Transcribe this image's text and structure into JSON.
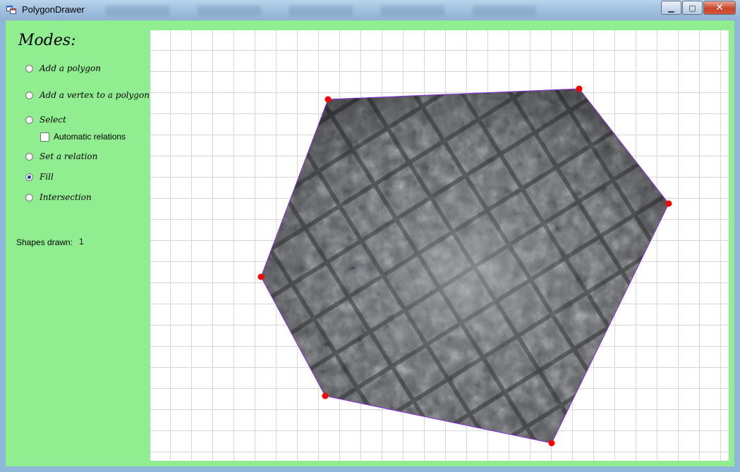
{
  "window": {
    "title": "PolygonDrawer",
    "icon": "app-window-icon",
    "controls": {
      "minimize": "minimize-icon",
      "maximize": "maximize-icon",
      "close": "close-icon"
    }
  },
  "sidebar": {
    "title": "Modes:",
    "modes": [
      {
        "label": "Add a polygon",
        "checked": false
      },
      {
        "label": "Add a vertex to a polygon",
        "checked": false
      },
      {
        "label": "Select",
        "checked": false
      },
      {
        "label": "Set a relation",
        "checked": false
      },
      {
        "label": "Fill",
        "checked": true
      },
      {
        "label": "Intersection",
        "checked": false
      }
    ],
    "automatic_relations": {
      "label": "Automatic relations",
      "checked": false
    },
    "shapes_drawn_label": "Shapes drawn:",
    "shapes_drawn_value": "1"
  },
  "canvas": {
    "grid": true,
    "fill": "stone-texture",
    "colors": {
      "edge": "#8a2be2",
      "vertex": "#ff0000",
      "background": "#90ee90"
    }
  }
}
